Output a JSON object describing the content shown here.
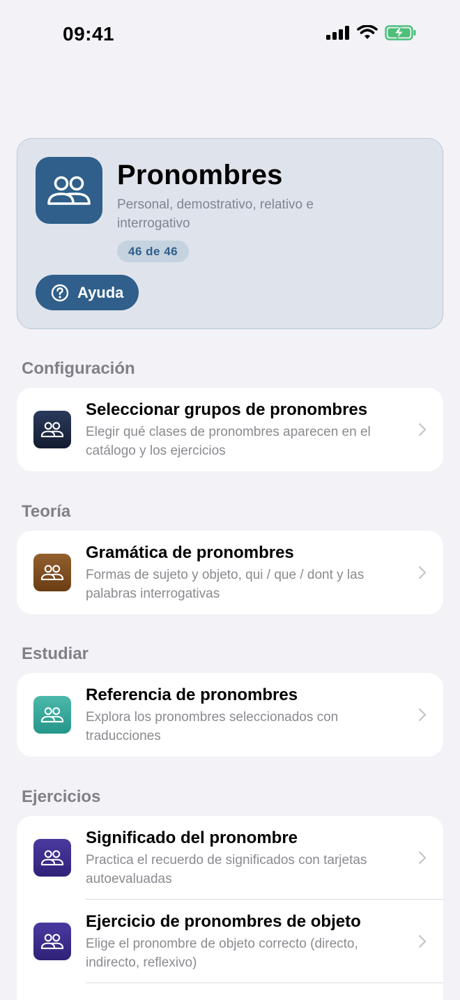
{
  "status": {
    "time": "09:41"
  },
  "hero": {
    "title": "Pronombres",
    "subtitle": "Personal, demostrativo, relativo e interrogativo",
    "badge": "46 de 46",
    "help_label": "Ayuda",
    "icon": "people-icon",
    "accent": "#2f5f8a"
  },
  "sections": {
    "config": {
      "header": "Configuración",
      "items": [
        {
          "title": "Seleccionar grupos de pronombres",
          "desc": "Elegir qué clases de pronombres aparecen en el catálogo y los ejercicios",
          "icon_color": "#1e2c4a"
        }
      ]
    },
    "theory": {
      "header": "Teoría",
      "items": [
        {
          "title": "Gramática de pronombres",
          "desc": "Formas de sujeto y objeto, qui / que / dont y las palabras interrogativas",
          "icon_color": "#7a4a1e"
        }
      ]
    },
    "study": {
      "header": "Estudiar",
      "items": [
        {
          "title": "Referencia de pronombres",
          "desc": "Explora los pronombres seleccionados con traducciones",
          "icon_color": "#2fa295"
        }
      ]
    },
    "exercises": {
      "header": "Ejercicios",
      "items": [
        {
          "title": "Significado del pronombre",
          "desc": "Practica el recuerdo de significados con tarjetas autoevaluadas",
          "icon_color": "#3d2f8f"
        },
        {
          "title": "Ejercicio de pronombres de objeto",
          "desc": "Elige el pronombre de objeto correcto (directo, indirecto, reflexivo)",
          "icon_color": "#3d2f8f"
        }
      ]
    }
  }
}
